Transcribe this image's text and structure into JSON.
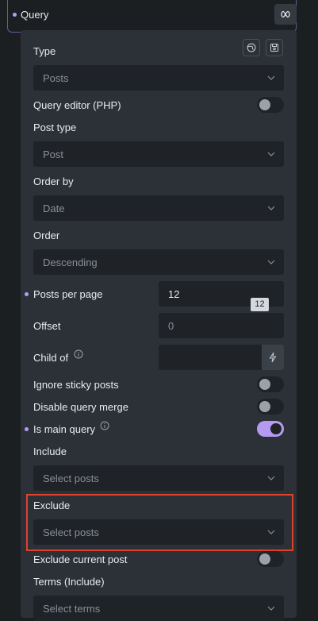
{
  "header": {
    "title": "Query"
  },
  "panel": {
    "type": {
      "label": "Type",
      "value": "Posts"
    },
    "query_editor": {
      "label": "Query editor (PHP)",
      "on": false
    },
    "post_type": {
      "label": "Post type",
      "value": "Post"
    },
    "order_by": {
      "label": "Order by",
      "value": "Date"
    },
    "order": {
      "label": "Order",
      "value": "Descending"
    },
    "posts_per_page": {
      "label": "Posts per page",
      "value": "12",
      "tooltip": "12"
    },
    "offset": {
      "label": "Offset",
      "placeholder": "0"
    },
    "child_of": {
      "label": "Child of",
      "value": ""
    },
    "ignore_sticky": {
      "label": "Ignore sticky posts",
      "on": false
    },
    "disable_merge": {
      "label": "Disable query merge",
      "on": false
    },
    "is_main_query": {
      "label": "Is main query",
      "on": true
    },
    "include": {
      "label": "Include",
      "placeholder": "Select posts"
    },
    "exclude": {
      "label": "Exclude",
      "placeholder": "Select posts"
    },
    "exclude_current": {
      "label": "Exclude current post",
      "on": false
    },
    "terms_include": {
      "label": "Terms (Include)",
      "placeholder": "Select terms"
    }
  },
  "colors": {
    "accent": "#b49af0",
    "highlight": "#e0412f",
    "panel_bg": "#2c3138",
    "field_bg": "#1f2226"
  }
}
